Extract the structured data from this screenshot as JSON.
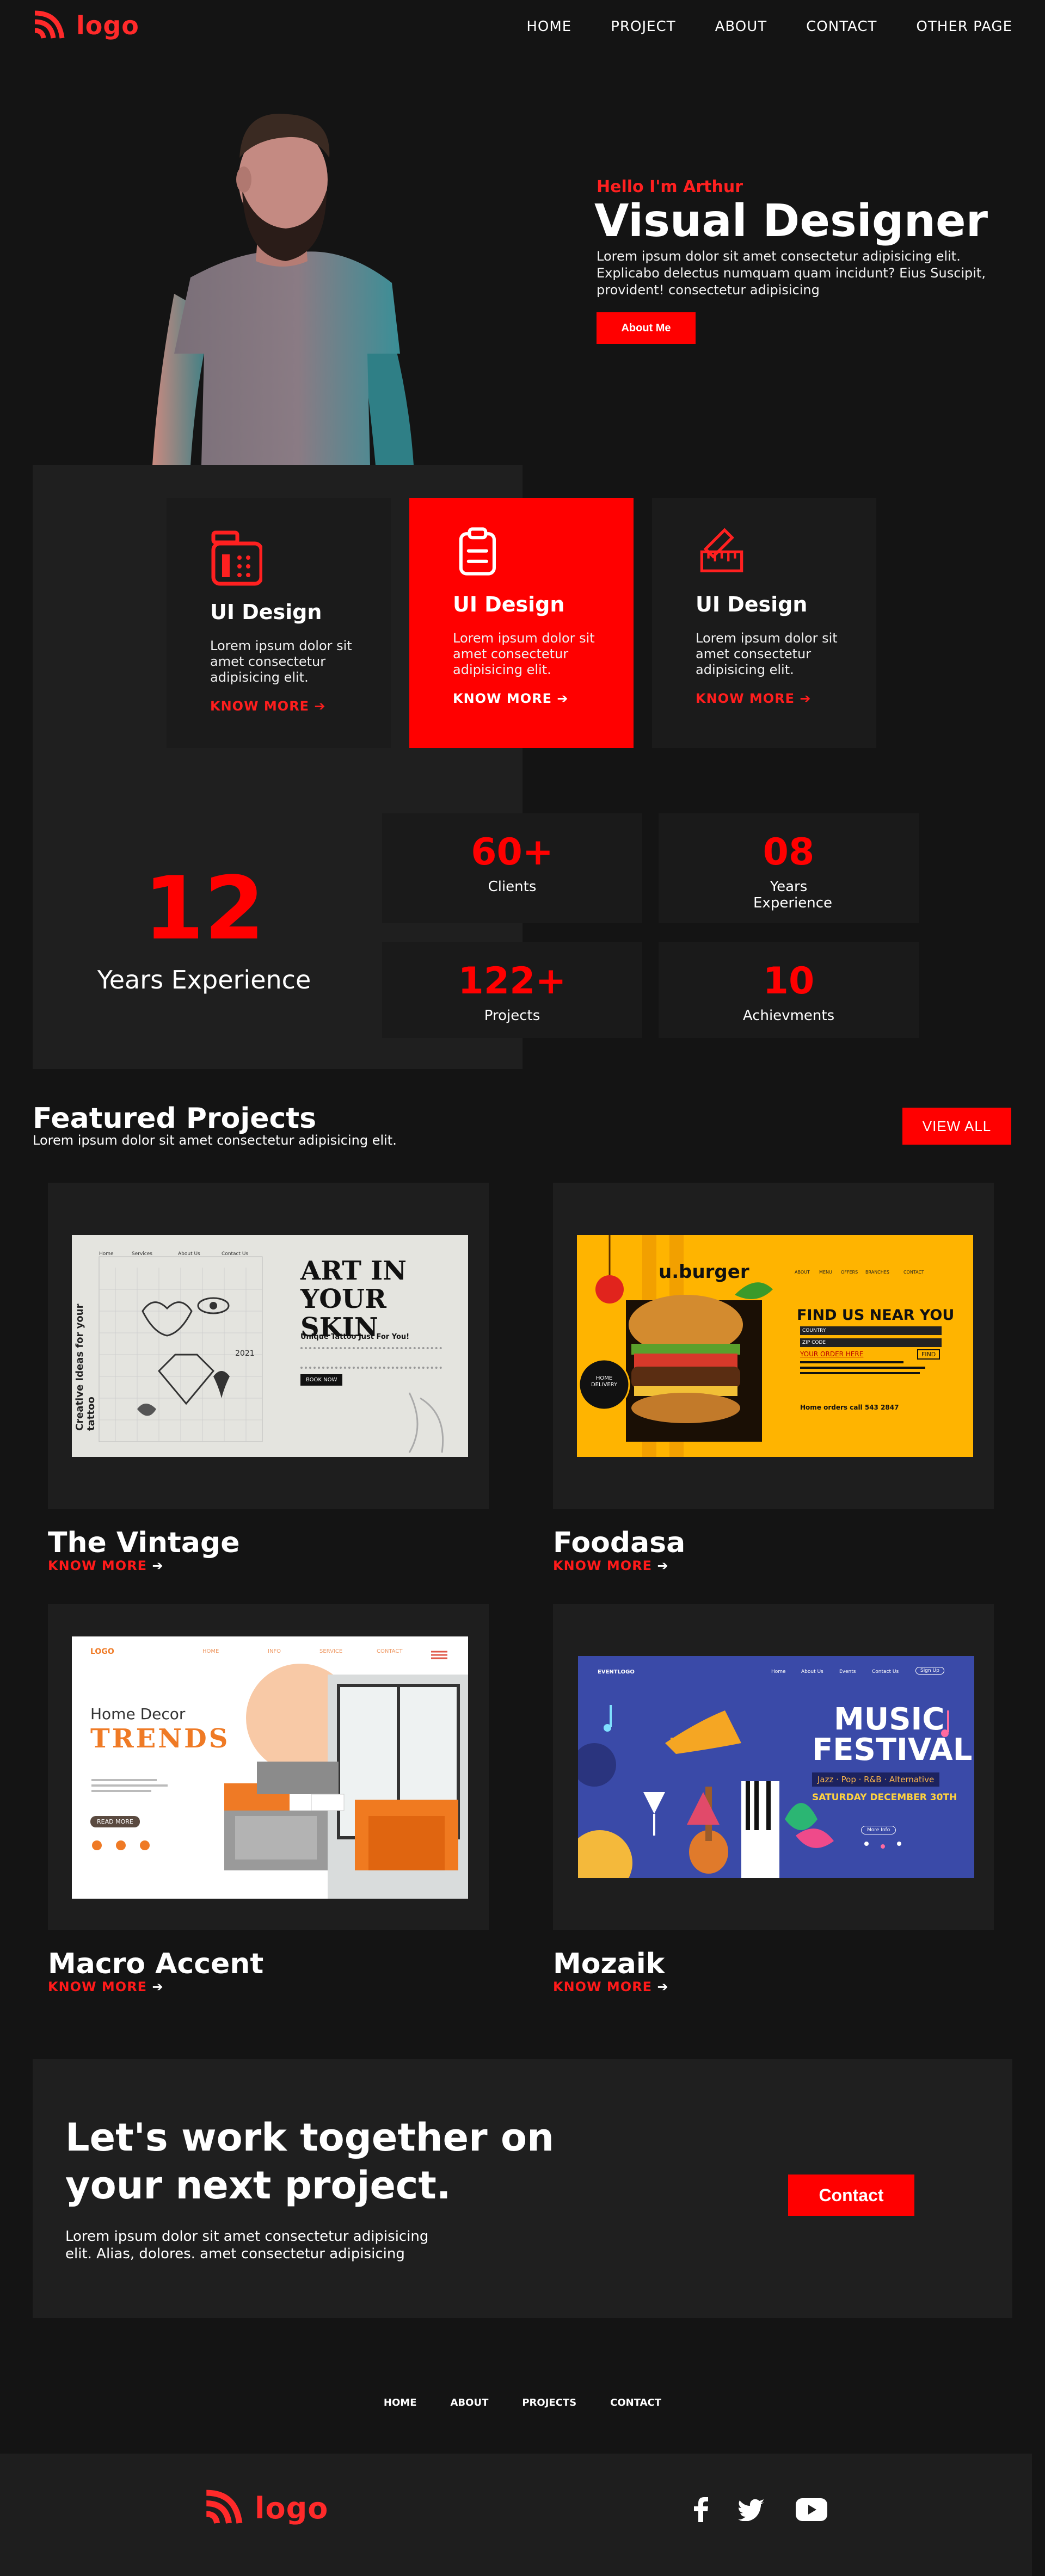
{
  "brand": {
    "logo_text": "logo",
    "accent": "#ff0000"
  },
  "nav": {
    "items": [
      "HOME",
      "PROJECT",
      "ABOUT",
      "CONTACT",
      "OTHER PAGE"
    ]
  },
  "hero": {
    "greeting": "Hello I'm Arthur",
    "title": "Visual Designer",
    "text": "Lorem ipsum dolor sit amet consectetur adipisicing elit. Explicabo delectus numquam quam incidunt? Eius Suscipit, provident! consectetur adipisicing",
    "button": "About Me"
  },
  "services": [
    {
      "title": "UI Design",
      "text": "Lorem ipsum dolor sit amet consectetur adipisicing elit.",
      "link": "KNOW MORE",
      "icon": "atm-icon",
      "active": false
    },
    {
      "title": "UI Design",
      "text": "Lorem ipsum dolor sit amet consectetur adipisicing elit.",
      "link": "KNOW MORE",
      "icon": "clipboard-icon",
      "active": true
    },
    {
      "title": "UI Design",
      "text": "Lorem ipsum dolor sit amet consectetur adipisicing elit.",
      "link": "KNOW MORE",
      "icon": "ruler-pencil-icon",
      "active": false
    }
  ],
  "experience": {
    "years": "12",
    "label": "Years Experience",
    "stats": [
      {
        "value": "60+",
        "label": "Clients"
      },
      {
        "value": "08",
        "label": "Years Experience"
      },
      {
        "value": "122+",
        "label": "Projects"
      },
      {
        "value": "10",
        "label": "Achievments"
      }
    ]
  },
  "featured": {
    "title": "Featured Projects",
    "subtitle": "Lorem ipsum dolor sit amet consectetur adipisicing elit.",
    "view_all": "VIEW ALL",
    "projects": [
      {
        "name": "The Vintage",
        "link": "KNOW MORE"
      },
      {
        "name": "Foodasa",
        "link": "KNOW MORE"
      },
      {
        "name": "Macro Accent",
        "link": "KNOW MORE"
      },
      {
        "name": "Mozaik",
        "link": "KNOW MORE"
      }
    ],
    "thumbs": {
      "vintage": {
        "nav": [
          "Home",
          "Services",
          "About Us",
          "Contact Us"
        ],
        "headline": "ART IN YOUR SKIN",
        "side": "Creative Ideas for your tattoo",
        "sub": "Unique Tattoo Just For You!",
        "btn": "BOOK NOW",
        "year": "2021"
      },
      "burger": {
        "brand": "u.burger",
        "nav": [
          "ABOUT",
          "MENU",
          "OFFERS",
          "BRANCHES",
          "CONTACT"
        ],
        "heading": "FIND US NEAR YOU",
        "country": "COUNTRY",
        "zip": "ZIP CODE",
        "order": "YOUR ORDER HERE",
        "find": "FIND",
        "badge": "HOME DELIVERY",
        "phone": "Home orders call 543 2847"
      },
      "decor": {
        "logo": "LOGO",
        "nav": [
          "HOME",
          "INFO",
          "SERVICE",
          "CONTACT"
        ],
        "line1": "Home Decor",
        "line2": "TRENDS",
        "btn": "READ MORE"
      },
      "music": {
        "brand": "EVENTLOGO",
        "nav": [
          "Home",
          "About Us",
          "Events",
          "Contact Us"
        ],
        "signup": "Sign Up",
        "title1": "MUSIC",
        "title2": "FESTIVAL",
        "genres": "Jazz · Pop · R&B · Alternative",
        "date": "SATURDAY DECEMBER 30TH",
        "btn": "More Info"
      }
    }
  },
  "collab": {
    "title": "Let's work together on your next project.",
    "text": "Lorem ipsum dolor sit amet consectetur adipisicing elit. Alias, dolores. amet consectetur adipisicing",
    "button": "Contact"
  },
  "footer": {
    "nav": [
      "HOME",
      "ABOUT",
      "PROJECTS",
      "CONTACT"
    ],
    "logo_text": "logo",
    "social": [
      "facebook-icon",
      "twitter-icon",
      "youtube-icon"
    ]
  }
}
